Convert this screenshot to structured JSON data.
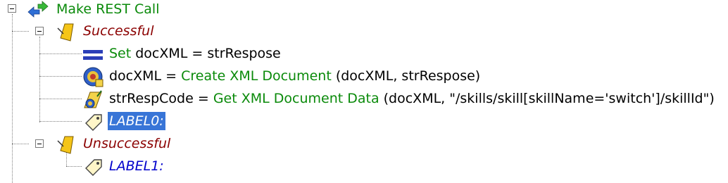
{
  "tree": {
    "root": {
      "label": "Make REST Call",
      "icon": "rest-call-icon"
    },
    "successful": {
      "label": "Successful",
      "icon": "branch-tag-icon"
    },
    "set_row": {
      "keyword": "Set",
      "text": "docXML = strRespose",
      "icon": "set-equals-icon"
    },
    "create_row": {
      "prefix": "docXML = ",
      "function": "Create XML Document",
      "args": "(docXML, strRespose)",
      "icon": "xml-document-icon"
    },
    "get_row": {
      "prefix": "strRespCode = ",
      "function": "Get XML Document Data",
      "args": "(docXML, \"/skills/skill[skillName='switch']/skillId\")",
      "icon": "xml-data-icon"
    },
    "label0": {
      "label": "LABEL0:",
      "icon": "label-tag-icon",
      "selected": true
    },
    "unsuccessful": {
      "label": "Unsuccessful",
      "icon": "branch-tag-icon"
    },
    "label1": {
      "label": "LABEL1:",
      "icon": "label-tag-icon"
    }
  },
  "colors": {
    "function_green": "#0a8a0a",
    "branch_red": "#8b0000",
    "label_blue": "#0000cc",
    "selection": "#3875d7"
  }
}
